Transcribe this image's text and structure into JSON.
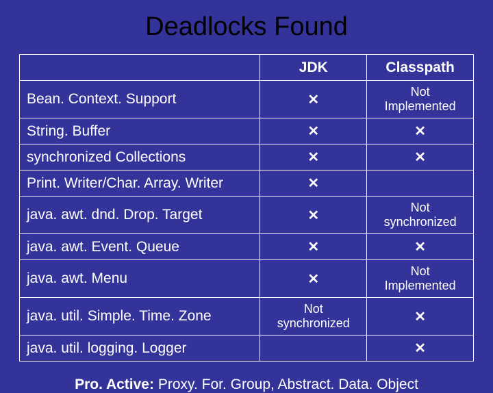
{
  "title": "Deadlocks Found",
  "header": {
    "col0": "",
    "col1": "JDK",
    "col2": "Classpath"
  },
  "x": "✕",
  "rows": [
    {
      "name": "Bean. Context. Support",
      "jdk": "✕",
      "cp": "Not Implemented"
    },
    {
      "name": "String. Buffer",
      "jdk": "✕",
      "cp": "✕"
    },
    {
      "name": "synchronized Collections",
      "jdk": "✕",
      "cp": "✕"
    },
    {
      "name": "Print. Writer/Char. Array. Writer",
      "jdk": "✕",
      "cp": ""
    },
    {
      "name": "java. awt. dnd. Drop. Target",
      "jdk": "✕",
      "cp": "Not synchronized"
    },
    {
      "name": "java. awt. Event. Queue",
      "jdk": "✕",
      "cp": "✕"
    },
    {
      "name": "java. awt. Menu",
      "jdk": "✕",
      "cp": "Not Implemented"
    },
    {
      "name": "java. util. Simple. Time. Zone",
      "jdk": "Not synchronized",
      "cp": "✕"
    },
    {
      "name": "java. util. logging. Logger",
      "jdk": "",
      "cp": "✕"
    }
  ],
  "footer": {
    "bold": "Pro. Active: ",
    "rest": "Proxy. For. Group, Abstract. Data. Object"
  },
  "chart_data": {
    "type": "table",
    "title": "Deadlocks Found",
    "columns": [
      "",
      "JDK",
      "Classpath"
    ],
    "rows": [
      [
        "Bean. Context. Support",
        "x",
        "Not Implemented"
      ],
      [
        "String. Buffer",
        "x",
        "x"
      ],
      [
        "synchronized Collections",
        "x",
        "x"
      ],
      [
        "Print. Writer/Char. Array. Writer",
        "x",
        ""
      ],
      [
        "java. awt. dnd. Drop. Target",
        "x",
        "Not synchronized"
      ],
      [
        "java. awt. Event. Queue",
        "x",
        "x"
      ],
      [
        "java. awt. Menu",
        "x",
        "Not Implemented"
      ],
      [
        "java. util. Simple. Time. Zone",
        "Not synchronized",
        "x"
      ],
      [
        "java. util. logging. Logger",
        "",
        "x"
      ]
    ],
    "footnote": "Pro. Active: Proxy. For. Group, Abstract. Data. Object"
  }
}
